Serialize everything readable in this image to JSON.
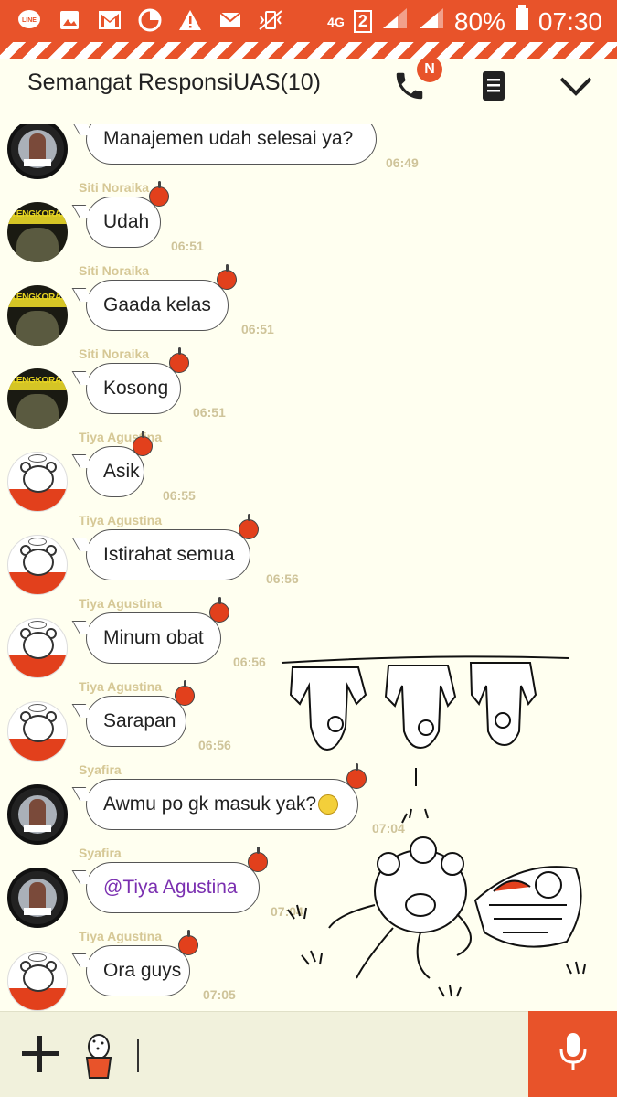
{
  "status_bar": {
    "signal_text": "4G",
    "sim_slot": "2",
    "battery": "80%",
    "clock": "07:30",
    "icons": [
      "line-icon",
      "gallery-icon",
      "gmail-icon",
      "chart-icon",
      "warning-icon",
      "mail-icon",
      "vibrate-icon"
    ]
  },
  "header": {
    "title": "Semangat ResponsiUAS(10)",
    "call_badge": "N",
    "icons": [
      "phone-icon",
      "notes-icon",
      "chevron-down-icon"
    ]
  },
  "messages": [
    {
      "sender": "",
      "text": "Manajemen udah selesai ya?",
      "time": "06:49",
      "avatar": "photo"
    },
    {
      "sender": "Siti Noraika",
      "text": "Udah",
      "time": "06:51",
      "avatar": "tengkorak"
    },
    {
      "sender": "Siti Noraika",
      "text": "Gaada kelas",
      "time": "06:51",
      "avatar": "tengkorak"
    },
    {
      "sender": "Siti Noraika",
      "text": "Kosong",
      "time": "06:51",
      "avatar": "tengkorak"
    },
    {
      "sender": "Tiya Agustina",
      "text": "Asik",
      "time": "06:55",
      "avatar": "bear"
    },
    {
      "sender": "Tiya Agustina",
      "text": "Istirahat semua",
      "time": "06:56",
      "avatar": "bear"
    },
    {
      "sender": "Tiya Agustina",
      "text": "Minum obat",
      "time": "06:56",
      "avatar": "bear"
    },
    {
      "sender": "Tiya Agustina",
      "text": "Sarapan",
      "time": "06:56",
      "avatar": "bear"
    },
    {
      "sender": "Syafira",
      "text": "Awmu po gk masuk yak?",
      "time": "07:04",
      "avatar": "photo"
    },
    {
      "sender": "Syafira",
      "text": "@Tiya Agustina",
      "time": "07:04",
      "avatar": "photo"
    },
    {
      "sender": "Tiya Agustina",
      "text": "Ora guys",
      "time": "07:05",
      "avatar": "bear"
    }
  ],
  "avatar_text": {
    "tengkorak": "TENGKORAK"
  },
  "input": {
    "placeholder": ""
  },
  "colors": {
    "accent": "#e8532a",
    "background": "#fffff0",
    "mention": "#7a2fb0",
    "meta": "#d6c896"
  }
}
